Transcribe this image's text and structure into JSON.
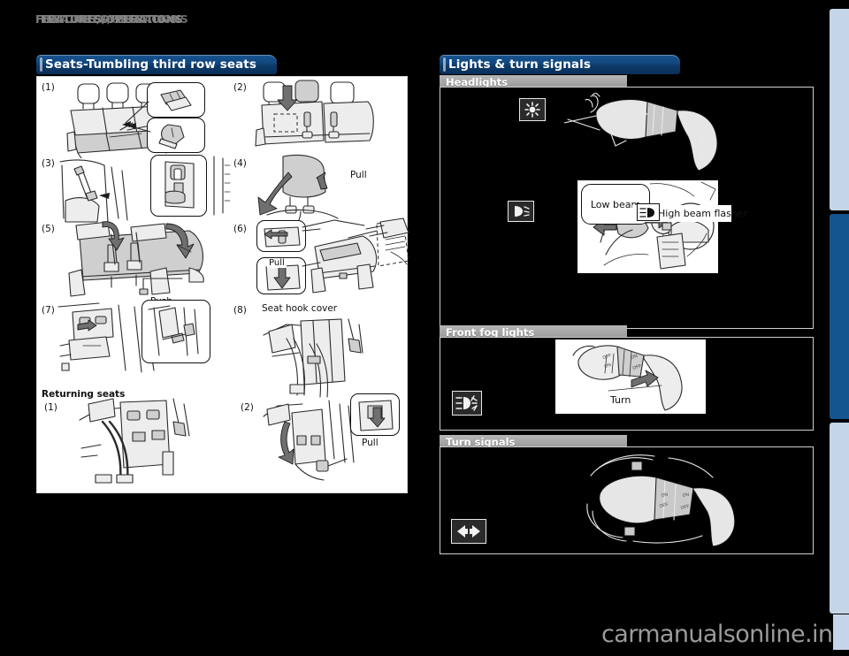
{
  "page": {
    "background_color": "#000000",
    "header_title": "FEATURES/OPERATIONS",
    "header_title_shadow": "FEATURES/OPERATIONS",
    "watermark": "carmanualsonline.info"
  },
  "left_section": {
    "banner_label": "Seats-Tumbling third row seats",
    "banner_color": "#10467d",
    "steps": [
      {
        "num": "(1)",
        "caption": ""
      },
      {
        "num": "(2)",
        "caption": ""
      },
      {
        "num": "(3)",
        "caption": ""
      },
      {
        "num": "(4)",
        "caption": "Pull"
      },
      {
        "num": "(5)",
        "caption": "Push"
      },
      {
        "num": "(6)",
        "caption": "Pull"
      },
      {
        "num": "(7)",
        "caption": ""
      },
      {
        "num": "(8)",
        "caption": "Seat hook cover"
      }
    ],
    "returning": {
      "heading": "Returning seats",
      "steps": [
        {
          "num": "(1)",
          "caption": ""
        },
        {
          "num": "(2)",
          "caption": "Pull"
        }
      ]
    }
  },
  "right_section": {
    "banner_label": "Lights & turn signals",
    "banner_color": "#10467d",
    "subsections": [
      {
        "label": "Headlights",
        "icons": [
          "headlight-symbol-icon",
          "low-beam-symbol-icon"
        ],
        "callouts": [
          "Low beam",
          "High beam flasher"
        ]
      },
      {
        "label": "Front fog lights",
        "icons": [
          "fog-light-symbol-icon"
        ],
        "callouts": [
          "Turn"
        ]
      },
      {
        "label": "Turn signals",
        "icons": [
          "turn-signal-symbol-icon"
        ],
        "callouts": []
      }
    ]
  },
  "tab_rail": {
    "tab_color": "#c4d5e8",
    "active_tab_color": "#14548f",
    "tabs": [
      {
        "name": "tab-1",
        "active": false
      },
      {
        "name": "tab-2",
        "active": true
      },
      {
        "name": "tab-3",
        "active": false
      }
    ]
  }
}
